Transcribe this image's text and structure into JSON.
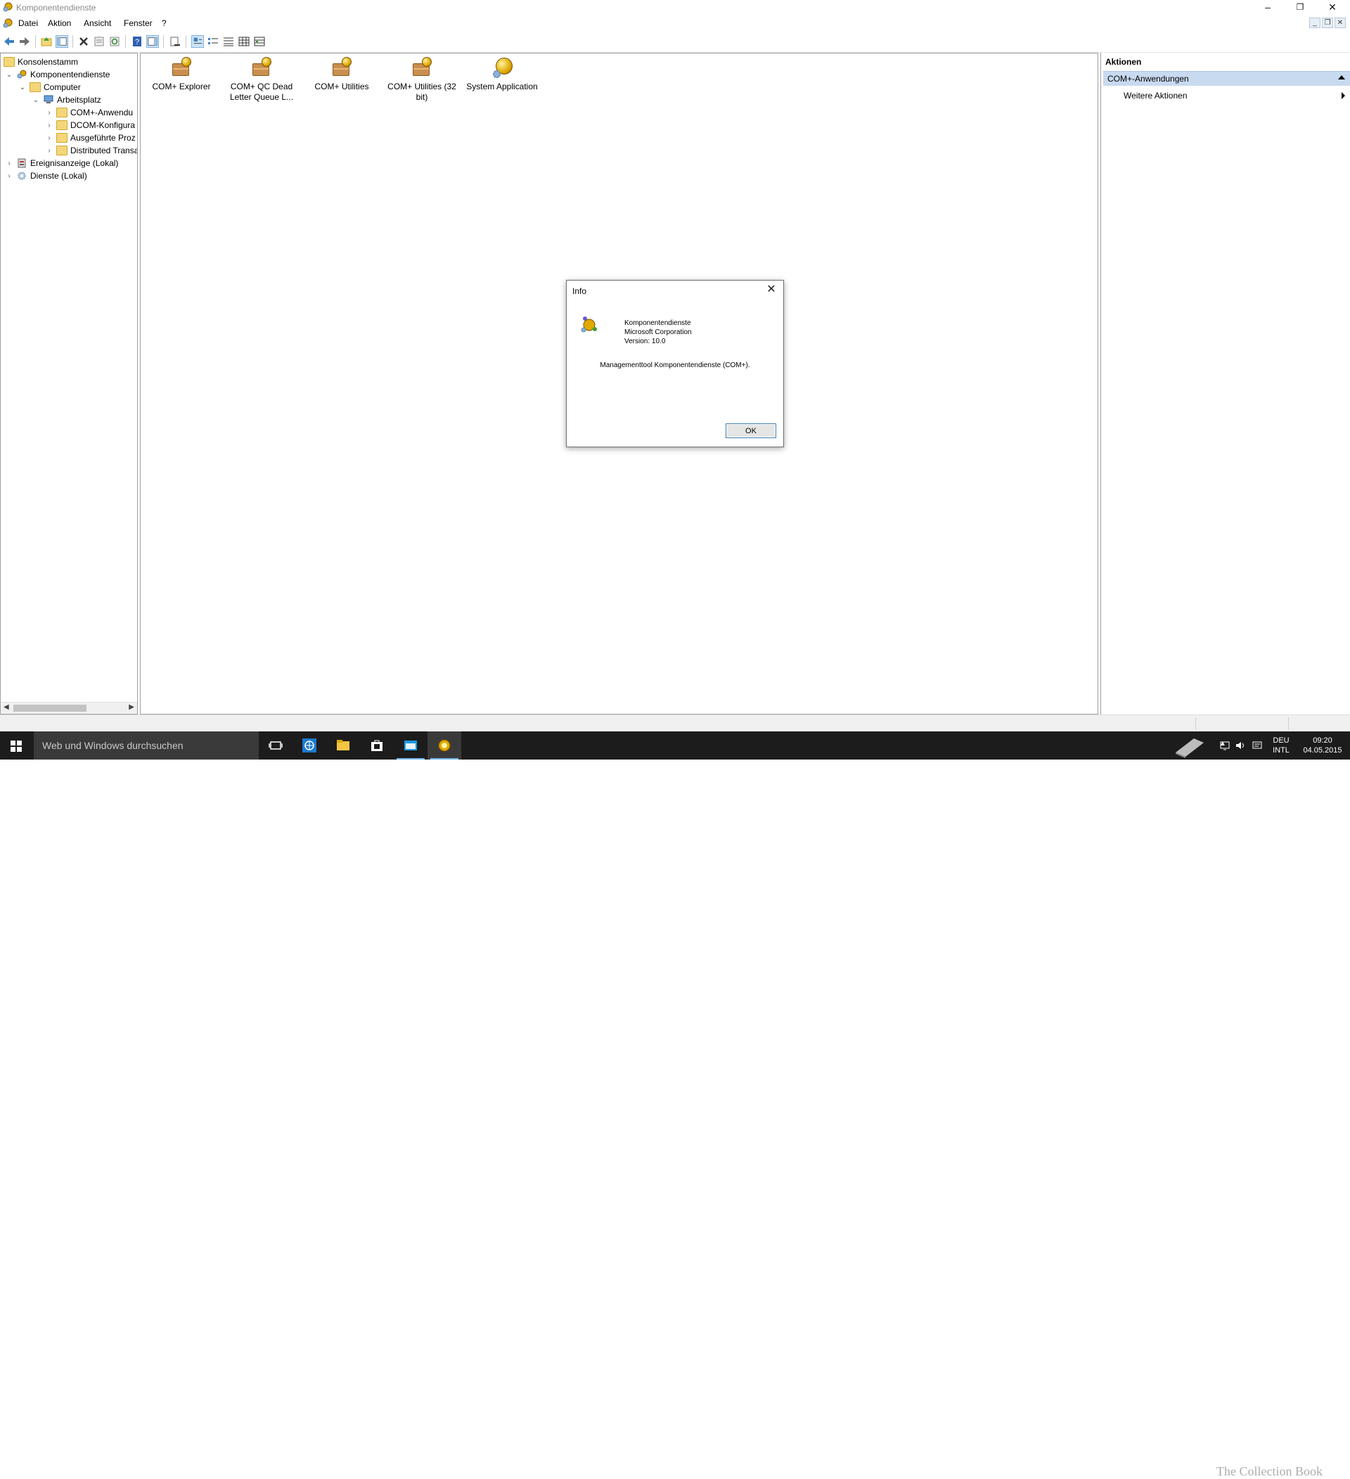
{
  "window": {
    "title": "Komponentendienste",
    "minimize": "–",
    "maximize": "❐",
    "close": "✕"
  },
  "menu": {
    "items": [
      "Datei",
      "Aktion",
      "Ansicht",
      "Fenster",
      "?"
    ],
    "mdi_buttons": [
      "_",
      "❐",
      "✕"
    ]
  },
  "toolbar": {
    "buttons": [
      "back-icon",
      "forward-icon",
      "up-folder-icon",
      "show-hide-tree-icon",
      "delete-icon",
      "properties-icon",
      "refresh-icon",
      "help-icon",
      "show-hide-action-pane-icon",
      "export-list-icon",
      "large-icons-icon",
      "small-icons-icon",
      "list-icon",
      "detail-icon",
      "status-view-icon"
    ]
  },
  "tree": {
    "items": [
      {
        "label": "Konsolenstamm",
        "level": 0,
        "expander": ""
      },
      {
        "label": "Komponentendienste",
        "level": 1,
        "expander": "v"
      },
      {
        "label": "Computer",
        "level": 2,
        "expander": "v"
      },
      {
        "label": "Arbeitsplatz",
        "level": 3,
        "expander": "v"
      },
      {
        "label": "COM+-Anwendu",
        "level": 4,
        "expander": ">"
      },
      {
        "label": "DCOM-Konfigura",
        "level": 4,
        "expander": ">"
      },
      {
        "label": "Ausgeführte Proz",
        "level": 4,
        "expander": ">"
      },
      {
        "label": "Distributed Transa",
        "level": 4,
        "expander": ">"
      },
      {
        "label": "Ereignisanzeige (Lokal)",
        "level": 1,
        "expander": ">"
      },
      {
        "label": "Dienste (Lokal)",
        "level": 1,
        "expander": ">"
      }
    ]
  },
  "content": {
    "items": [
      {
        "label": "COM+ Explorer"
      },
      {
        "label": "COM+ QC Dead Letter Queue L..."
      },
      {
        "label": "COM+ Utilities"
      },
      {
        "label": "COM+ Utilities (32 bit)"
      },
      {
        "label": "System Application"
      }
    ]
  },
  "actions": {
    "title": "Aktionen",
    "section": "COM+-Anwendungen",
    "items": [
      "Weitere Aktionen"
    ]
  },
  "dialog": {
    "title": "Info",
    "close": "✕",
    "product": "Komponentendienste",
    "company": "Microsoft Corporation",
    "version": "Version: 10.0",
    "description": "Managementtool Komponentendienste (COM+).",
    "ok": "OK"
  },
  "taskbar": {
    "search_placeholder": "Web und Windows durchsuchen",
    "language_top": "DEU",
    "language_bottom": "INTL",
    "time": "09:20",
    "date": "04.05.2015",
    "watermark": "The Collection Book"
  },
  "colors": {
    "accent": "#76b9ed",
    "actions_header": "#c8daf0",
    "taskbar": "#1c1c1c"
  }
}
